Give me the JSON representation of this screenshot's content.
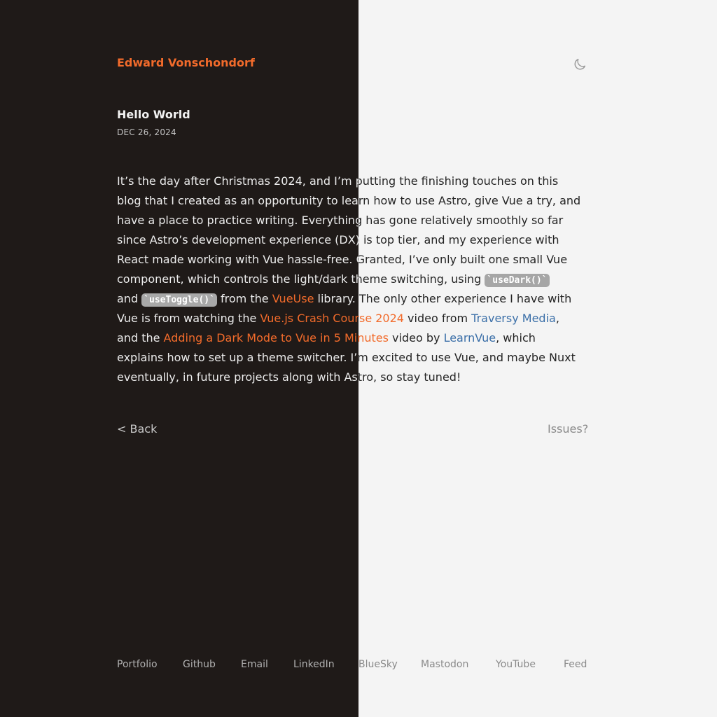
{
  "header": {
    "site_title": "Edward Vonschondorf",
    "theme_toggle_icon": "moon-icon"
  },
  "post": {
    "title": "Hello World",
    "date": "DEC 26, 2024"
  },
  "body": {
    "l1": "It’s the day after Christmas 2024, and I’m putting the finishing touches on this",
    "l2": "blog that I created as an opportunity to learn how to use Astro, give Vue a try, and",
    "l3": "have a place to practice writing. Everything has gone relatively smoothly so far",
    "l4": "since Astro’s development experience (DX) is top tier, and my experience with",
    "l5": "React made working with Vue hassle-free. Granted, I’ve only built one small Vue",
    "l6_a": "component, which controls the light/dark theme switching, using ",
    "code_use_dark": "`useDark()`",
    "l7_a": "and ",
    "code_use_toggle": "`useToggle()`",
    "l7_b": " from the ",
    "link_vueuse": "VueUse",
    "l7_c": " library. The only other experience I have with",
    "l8_a": "Vue is from watching the ",
    "link_crash_course": "Vue.js Crash Course 2024",
    "l8_b": " video from ",
    "link_traversy": "Traversy Media",
    "l8_c": ",",
    "l9_a": "and the ",
    "link_dark_mode": "Adding a Dark Mode to Vue in 5 Minutes",
    "l9_b": " video by ",
    "link_learnvue": "LearnVue",
    "l9_c": ", which",
    "l10": "explains how to set up a theme switcher. I’m excited to use Vue, and maybe Nuxt",
    "l11": "eventually, in future projects along with Astro, so stay tuned!"
  },
  "nav": {
    "back": "< Back",
    "issues": "Issues?"
  },
  "footer": {
    "portfolio": "Portfolio",
    "github": "Github",
    "email": "Email",
    "linkedin": "LinkedIn",
    "bluesky": "BlueSky",
    "mastodon": "Mastodon",
    "youtube": "YouTube",
    "feed": "Feed"
  },
  "colors": {
    "accent_orange": "#f26b2b",
    "link_blue": "#3b6fa8",
    "dark_bg": "#1f1a18",
    "light_bg": "#f4f4f4"
  }
}
